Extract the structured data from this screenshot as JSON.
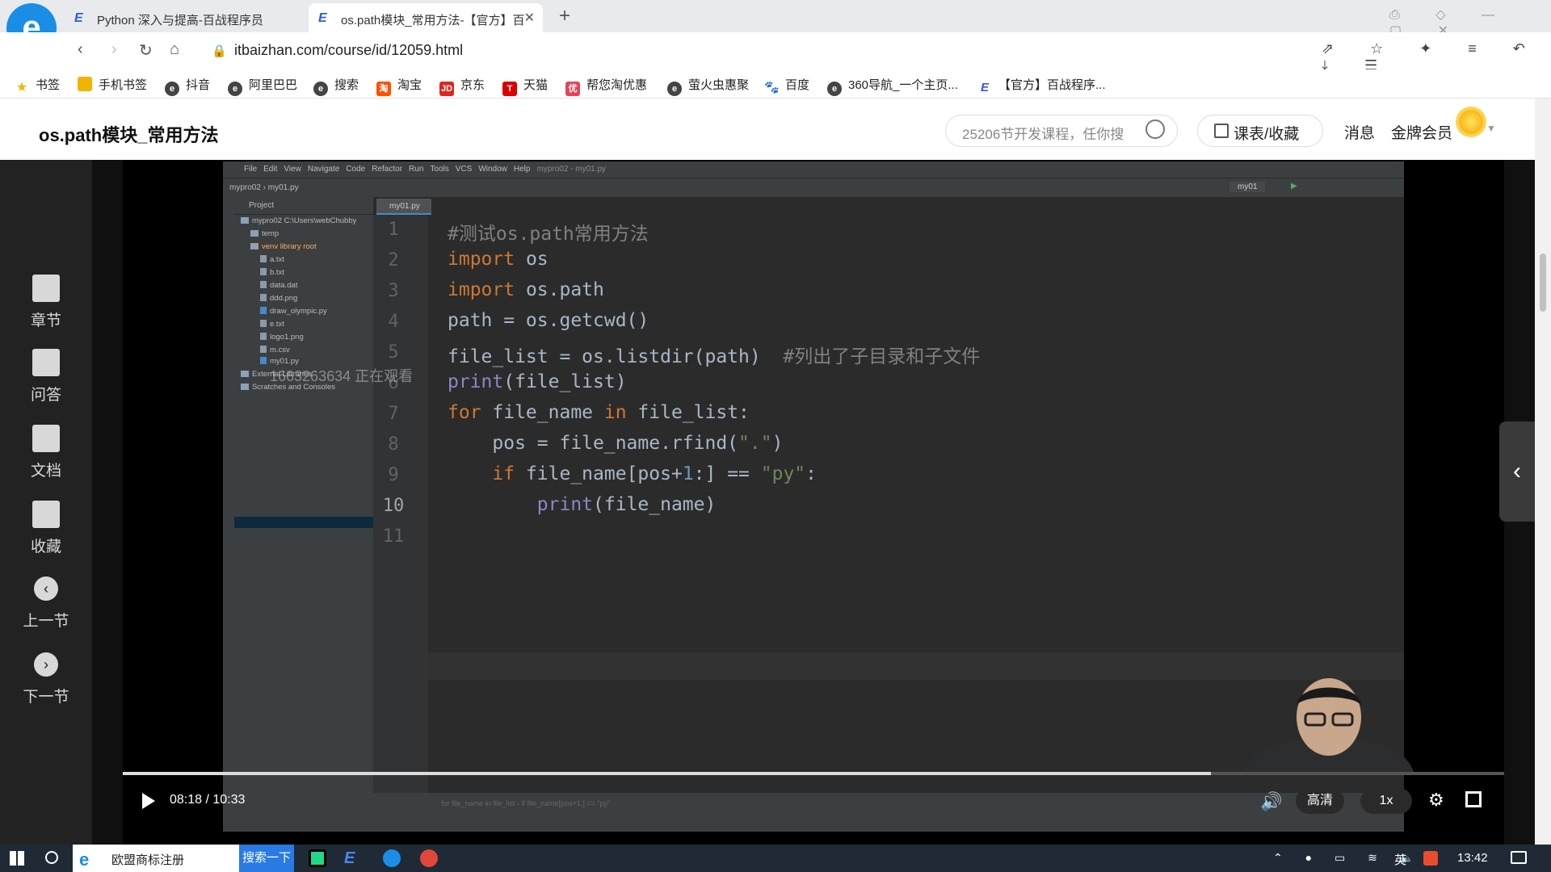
{
  "browser": {
    "tabs": [
      {
        "label": "Python 深入与提高-百战程序员"
      },
      {
        "label": "os.path模块_常用方法-【官方】百"
      }
    ],
    "url": "itbaizhan.com/course/id/12059.html",
    "bookmarks": [
      "书签",
      "手机书签",
      "抖音",
      "阿里巴巴",
      "搜索",
      "淘宝",
      "京东",
      "天猫",
      "帮您淘优惠",
      "萤火虫惠聚",
      "百度",
      "360导航_一个主页...",
      "【官方】百战程序..."
    ]
  },
  "site": {
    "page_title": "os.path模块_常用方法",
    "search_placeholder": "25206节开发课程，任你搜",
    "course_button": "课表/收藏",
    "messages": "消息",
    "vip": "金牌会员"
  },
  "sidenav": {
    "items": [
      {
        "label": "章节"
      },
      {
        "label": "问答"
      },
      {
        "label": "文档"
      },
      {
        "label": "收藏"
      },
      {
        "label": "上一节"
      },
      {
        "label": "下一节"
      }
    ]
  },
  "ide": {
    "menu": [
      "File",
      "Edit",
      "View",
      "Navigate",
      "Code",
      "Refactor",
      "Run",
      "Tools",
      "VCS",
      "Window",
      "Help",
      "mypro02 - my01.py"
    ],
    "breadcrumb": "mypro02  ›  my01.py",
    "run_config": "my01",
    "project_header": "Project",
    "tree": [
      {
        "label": "mypro02  C:\\Users\\webChubby"
      },
      {
        "label": "temp"
      },
      {
        "label": "venv  library root"
      },
      {
        "label": "a.txt"
      },
      {
        "label": "b.txt"
      },
      {
        "label": "data.dat"
      },
      {
        "label": "ddd.png"
      },
      {
        "label": "draw_olympic.py"
      },
      {
        "label": "e.txt"
      },
      {
        "label": "logo1.png"
      },
      {
        "label": "m.csv"
      },
      {
        "label": "my01.py"
      },
      {
        "label": "External Libraries"
      },
      {
        "label": "Scratches and Consoles"
      }
    ],
    "editor_tab": "my01.py",
    "line_numbers": [
      "1",
      "2",
      "3",
      "4",
      "5",
      "6",
      "7",
      "8",
      "9",
      "10",
      "11"
    ],
    "code": {
      "l1": "#测试os.path常用方法",
      "l2_kw": "import",
      "l2_rest": " os",
      "l3_kw": "import",
      "l3_rest": " os.path",
      "l4": "path = os.getcwd()",
      "l5_code": "file_list = os.listdir(path)  ",
      "l5_comment": "#列出了子目录和子文件",
      "l6_fn": "print",
      "l6_rest": "(file_list)",
      "l7_kw1": "for",
      "l7_mid": " file_name ",
      "l7_kw2": "in",
      "l7_rest": " file_list:",
      "l8_a": "    pos = file_name.rfind(",
      "l8_str": "\".\"",
      "l8_b": ")",
      "l9_kw": "    if",
      "l9_a": " file_name[pos+",
      "l9_num": "1",
      "l9_b": ":] == ",
      "l9_str": "\"py\"",
      "l9_c": ":",
      "l10_fn": "        print",
      "l10_rest": "(file_name)"
    },
    "status_bar": "for file_name in file_list  ›  if file_name[pos+1:] == \"py\""
  },
  "watermark": "1663263634 正在观看",
  "player": {
    "time": "08:18 / 10:33",
    "progress": 0.788,
    "quality": "高清",
    "speed": "1x"
  },
  "taskbar": {
    "search_text": "欧盟商标注册",
    "search_button": "搜索一下",
    "ime": "英",
    "clock": "13:42"
  }
}
